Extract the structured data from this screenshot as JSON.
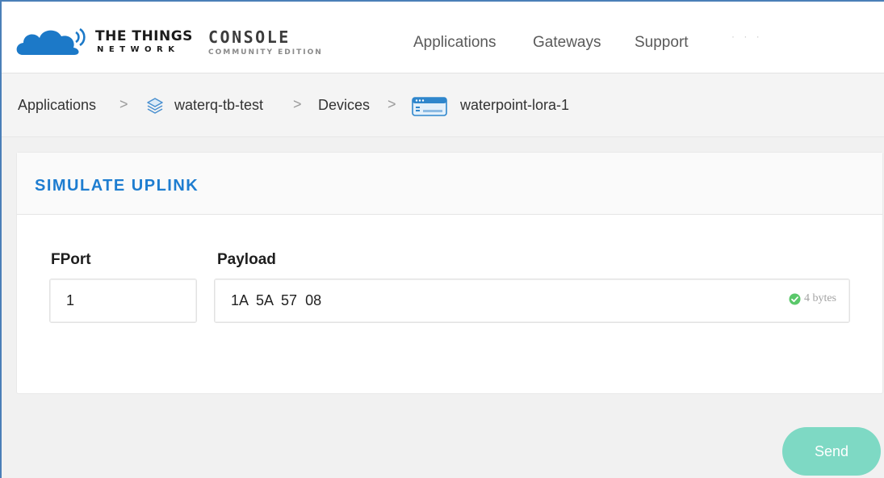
{
  "header": {
    "brand_line1": "THE THINGS",
    "brand_line2": "NETWORK",
    "console_line1": "CONSOLE",
    "console_line2": "COMMUNITY EDITION",
    "nav": [
      {
        "label": "Applications"
      },
      {
        "label": "Gateways"
      },
      {
        "label": "Support"
      }
    ],
    "user_label": "·  ·  ·"
  },
  "breadcrumb": {
    "items": [
      {
        "label": "Applications"
      },
      {
        "label": "waterq-tb-test",
        "icon": "stack-icon"
      },
      {
        "label": "Devices"
      },
      {
        "label": "waterpoint-lora-1",
        "icon": "device-icon"
      }
    ],
    "separator": ">"
  },
  "simulate": {
    "title": "SIMULATE UPLINK",
    "fport_label": "FPort",
    "fport_value": "1",
    "payload_label": "Payload",
    "payload_value": "1A  5A  57  08",
    "payload_size": "4 bytes",
    "payload_valid": true
  },
  "actions": {
    "send_label": "Send"
  },
  "colors": {
    "accent_blue": "#1e7dd0",
    "send_button": "#7ed9c4",
    "valid_green": "#5ac86a",
    "logo_blue": "#1c79c8"
  }
}
